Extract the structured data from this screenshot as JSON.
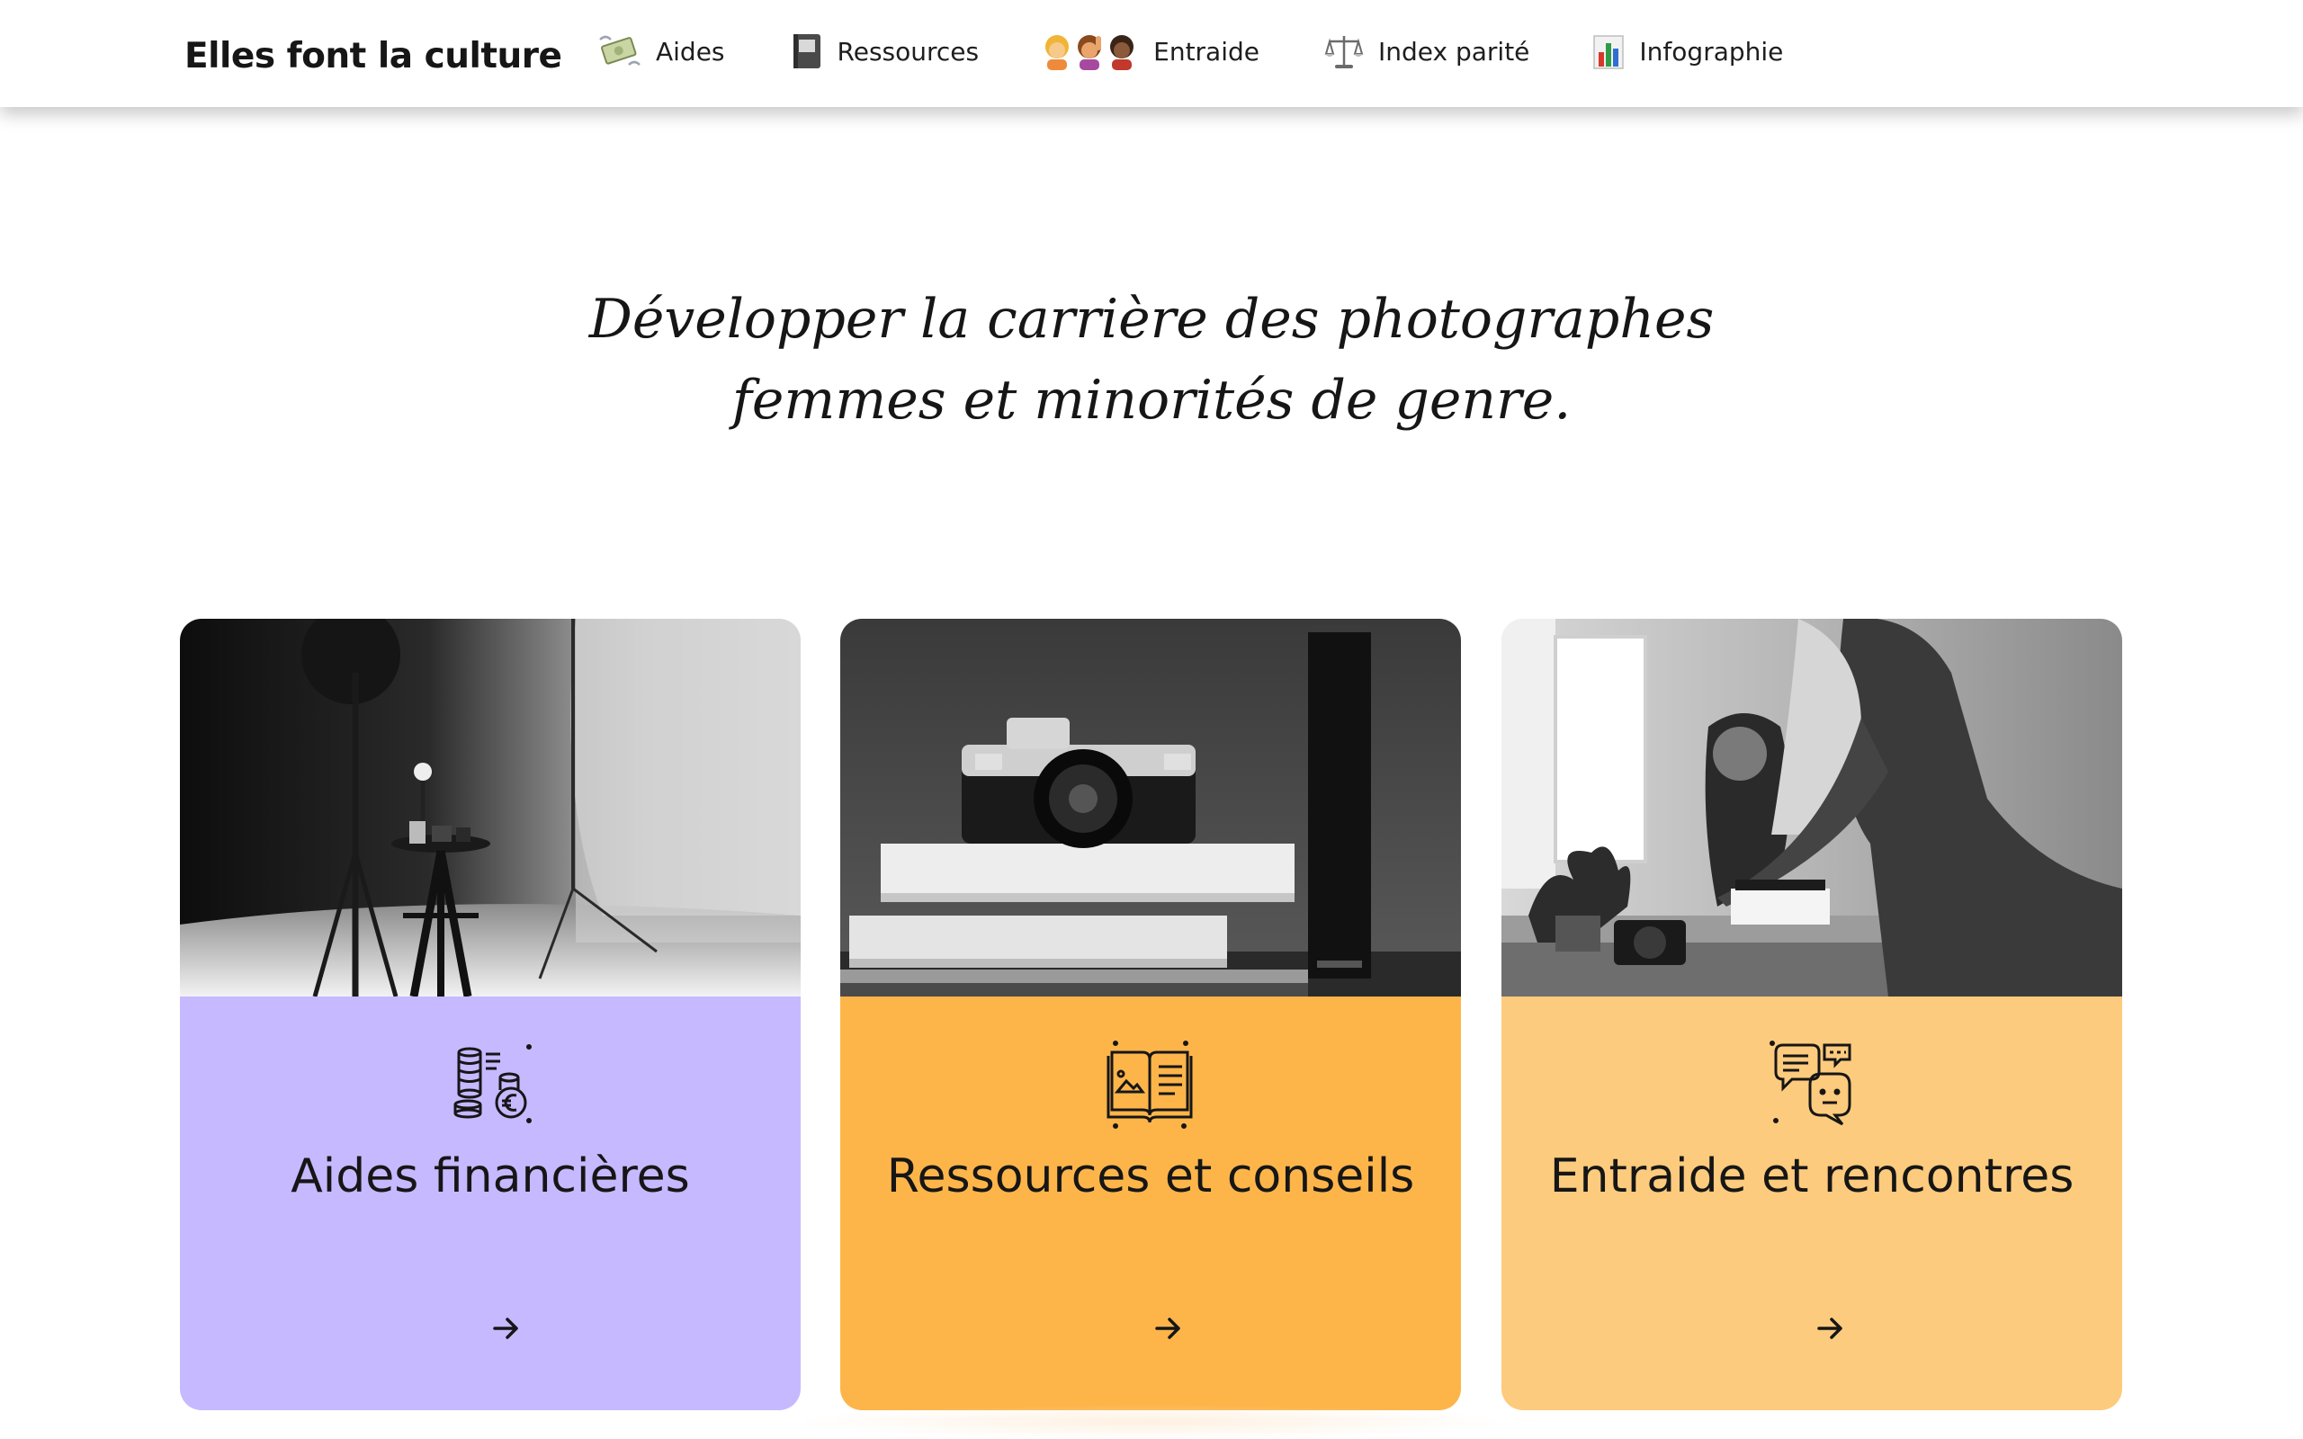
{
  "header": {
    "brand": "Elles font la culture",
    "nav": [
      {
        "label": "Aides",
        "icon": "money-with-wings-icon"
      },
      {
        "label": "Ressources",
        "icon": "notebook-icon"
      },
      {
        "label": "Entraide",
        "icon": "women-group-icon"
      },
      {
        "label": "Index parité",
        "icon": "balance-scale-icon"
      },
      {
        "label": "Infographie",
        "icon": "bar-chart-icon"
      }
    ]
  },
  "hero": {
    "line1": "Développer la carrière des photographes",
    "line2": "femmes et minorités de genre."
  },
  "cards": [
    {
      "title": "Aides financières",
      "icon": "coins-euro-icon",
      "photo": "studio-lighting-photo",
      "color": "#c6b9ff"
    },
    {
      "title": "Ressources et conseils",
      "icon": "open-book-icon",
      "photo": "camera-books-photo",
      "color": "#fdb54a"
    },
    {
      "title": "Entraide et rencontres",
      "icon": "chat-bubbles-icon",
      "photo": "women-working-photo",
      "color": "#fdcb7d"
    }
  ]
}
